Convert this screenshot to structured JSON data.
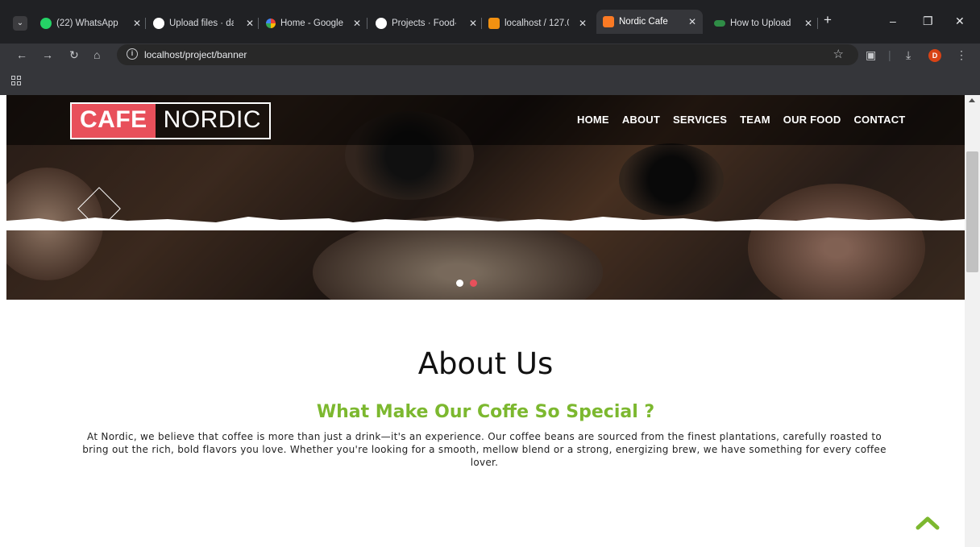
{
  "browser": {
    "tabs": [
      {
        "title": "(22) WhatsApp",
        "icon": "whatsapp-icon",
        "color": "#25d366"
      },
      {
        "title": "Upload files · da",
        "icon": "github-icon",
        "color": "#ffffff"
      },
      {
        "title": "Home - Google",
        "icon": "google-icon",
        "color": "#4285f4"
      },
      {
        "title": "Projects · Food-",
        "icon": "github-icon",
        "color": "#ffffff"
      },
      {
        "title": "localhost / 127.0",
        "icon": "phpmyadmin-icon",
        "color": "#f29111"
      },
      {
        "title": "Nordic Cafe",
        "icon": "xampp-icon",
        "color": "#fb7a24",
        "active": true
      },
      {
        "title": "How to Upload",
        "icon": "gfg-icon",
        "color": "#2f8d46"
      }
    ],
    "new_tab": "+",
    "url": "localhost/project/banner",
    "profile_initial": "D"
  },
  "site": {
    "logo_part1": "CAFE",
    "logo_part2": "NORDIC",
    "nav": [
      "HOME",
      "ABOUT",
      "SERVICES",
      "TEAM",
      "OUR FOOD",
      "CONTACT"
    ],
    "slider_active_dot": 1
  },
  "about": {
    "title": "About Us",
    "subtitle": "What Make Our Coffe So Special ?",
    "body": "At Nordic, we believe that coffee is more than just a drink—it's an experience. Our coffee beans are sourced from the finest plantations, carefully roasted to bring out the rich, bold flavors you love. Whether you're looking for a smooth, mellow blend or a strong, energizing brew, we have something for every coffee lover."
  },
  "colors": {
    "accent_red": "#e8505b",
    "accent_green": "#7cb82f"
  }
}
